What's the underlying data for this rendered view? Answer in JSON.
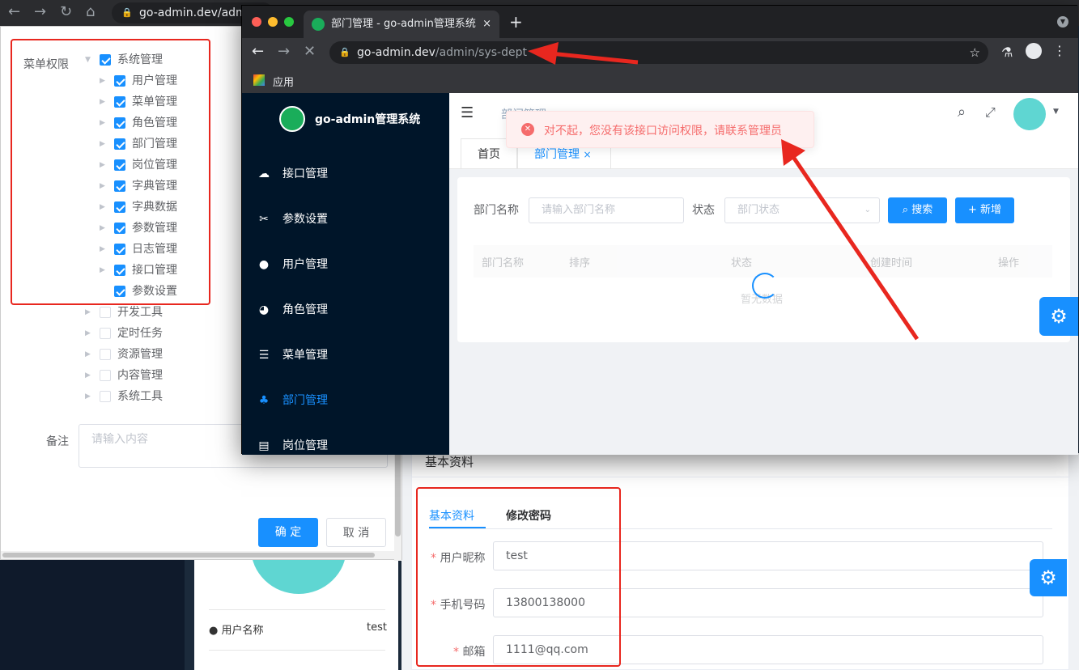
{
  "back_browser": {
    "url": "go-admin.dev/adm"
  },
  "dialog": {
    "menu_label": "菜单权限",
    "tree": [
      {
        "label": "系统管理",
        "checked": true,
        "level": 0,
        "expanded": true
      },
      {
        "label": "用户管理",
        "checked": true,
        "level": 1
      },
      {
        "label": "菜单管理",
        "checked": true,
        "level": 1
      },
      {
        "label": "角色管理",
        "checked": true,
        "level": 1
      },
      {
        "label": "部门管理",
        "checked": true,
        "level": 1
      },
      {
        "label": "岗位管理",
        "checked": true,
        "level": 1
      },
      {
        "label": "字典管理",
        "checked": true,
        "level": 1
      },
      {
        "label": "字典数据",
        "checked": true,
        "level": 1
      },
      {
        "label": "参数管理",
        "checked": true,
        "level": 1
      },
      {
        "label": "日志管理",
        "checked": true,
        "level": 1
      },
      {
        "label": "接口管理",
        "checked": true,
        "level": 1
      },
      {
        "label": "参数设置",
        "checked": true,
        "level": 1,
        "leaf": true
      },
      {
        "label": "开发工具",
        "checked": false,
        "level": 0
      },
      {
        "label": "定时任务",
        "checked": false,
        "level": 0
      },
      {
        "label": "资源管理",
        "checked": false,
        "level": 0
      },
      {
        "label": "内容管理",
        "checked": false,
        "level": 0
      },
      {
        "label": "系统工具",
        "checked": false,
        "level": 0
      }
    ],
    "remark_label": "备注",
    "remark_placeholder": "请输入内容",
    "confirm": "确 定",
    "cancel": "取 消"
  },
  "profile": {
    "section_title": "基本资料",
    "tabs": [
      "基本资料",
      "修改密码"
    ],
    "nickname_label": "用户昵称",
    "nickname": "test",
    "phone_label": "手机号码",
    "phone": "13800138000",
    "email_label": "邮箱",
    "email": "1111@qq.com",
    "username_label": "用户名称",
    "username": "test"
  },
  "front": {
    "tab_title": "部门管理 - go-admin管理系统",
    "url_host": "go-admin.dev",
    "url_path": "/admin/sys-dept",
    "bookmark": "应用",
    "app_name": "go-admin管理系统",
    "menu": [
      {
        "label": "接口管理",
        "icon": "cloud-icon",
        "glyph": "☁"
      },
      {
        "label": "参数设置",
        "icon": "tools-icon",
        "glyph": "✂"
      },
      {
        "label": "用户管理",
        "icon": "user-icon",
        "glyph": "●"
      },
      {
        "label": "角色管理",
        "icon": "peoples-icon",
        "glyph": "◕"
      },
      {
        "label": "菜单管理",
        "icon": "tree-table-icon",
        "glyph": "☰"
      },
      {
        "label": "部门管理",
        "icon": "tree-icon",
        "glyph": "♣",
        "active": true
      },
      {
        "label": "岗位管理",
        "icon": "post-icon",
        "glyph": "▤"
      }
    ],
    "breadcrumb": "部门管理",
    "error_message": "对不起，您没有该接口访问权限，请联系管理员",
    "tags": [
      "首页",
      "部门管理"
    ],
    "search": {
      "dept_label": "部门名称",
      "dept_placeholder": "请输入部门名称",
      "status_label": "状态",
      "status_placeholder": "部门状态",
      "search_btn": "搜索",
      "add_btn": "新增"
    },
    "table_headers": [
      "部门名称",
      "排序",
      "状态",
      "创建时间",
      "操作"
    ],
    "empty_text": "暂无数据"
  },
  "colors": {
    "primary": "#1890ff",
    "error": "#f56c6c",
    "sidebar": "#001529",
    "annotation": "#e8271f"
  }
}
